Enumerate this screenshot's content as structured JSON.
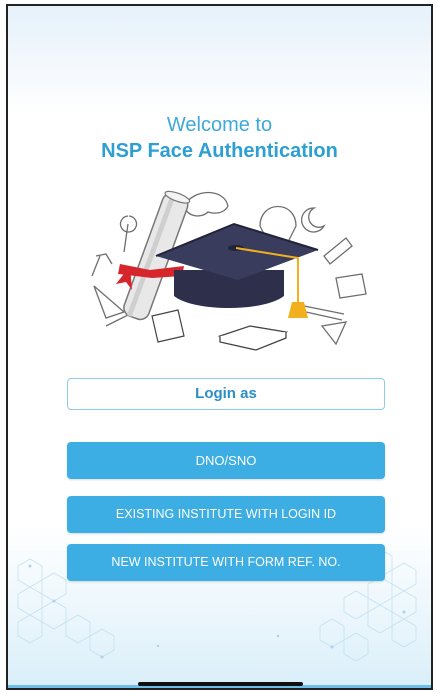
{
  "header": {
    "welcome_text": "Welcome to",
    "app_name": "NSP Face Authentication"
  },
  "illustration": {
    "icon": "graduation-cap-diploma-illustration"
  },
  "login": {
    "label": "Login as",
    "options": [
      "DNO/SNO",
      "EXISTING INSTITUTE WITH LOGIN ID",
      "NEW INSTITUTE WITH FORM REF. NO."
    ]
  },
  "colors": {
    "accent": "#3daee4",
    "title": "#2d9fd3",
    "cap": "#2e2f4a",
    "ribbon": "#d6252b",
    "tassel": "#f2b01e"
  }
}
